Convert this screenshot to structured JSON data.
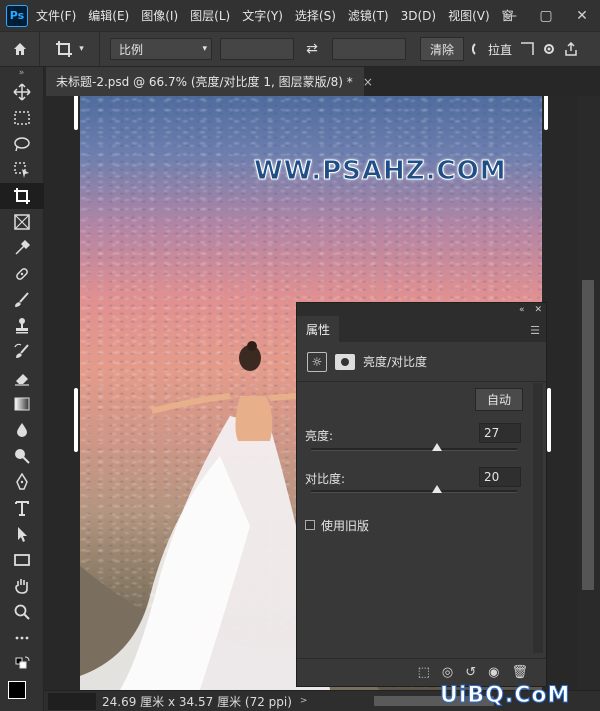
{
  "menubar": {
    "logo": "Ps",
    "items": [
      "文件(F)",
      "编辑(E)",
      "图像(I)",
      "图层(L)",
      "文字(Y)",
      "选择(S)",
      "滤镜(T)",
      "3D(D)",
      "视图(V)",
      "窗"
    ],
    "window_controls": [
      "—",
      "▢",
      "✕"
    ]
  },
  "options": {
    "ratio_select": "比例",
    "swap_symbol": "⇄",
    "clear_label": "清除",
    "straighten_label": "拉直"
  },
  "tab": {
    "title": "未标题-2.psd @ 66.7% (亮度/对比度 1, 图层蒙版/8) *",
    "close": "×"
  },
  "canvas": {
    "watermark": "WW.PSAHZ.COM"
  },
  "properties": {
    "tab_label": "属性",
    "panel_title": "亮度/对比度",
    "auto_label": "自动",
    "brightness_label": "亮度:",
    "brightness_value": "27",
    "brightness_fraction": 0.61,
    "contrast_label": "对比度:",
    "contrast_value": "20",
    "contrast_fraction": 0.61,
    "legacy_label": "使用旧版"
  },
  "status": {
    "doc_size": "24.69 厘米 x 34.57 厘米 (72 ppi)",
    "arrow": ">"
  },
  "site_logo": "UiBQ.CoM"
}
